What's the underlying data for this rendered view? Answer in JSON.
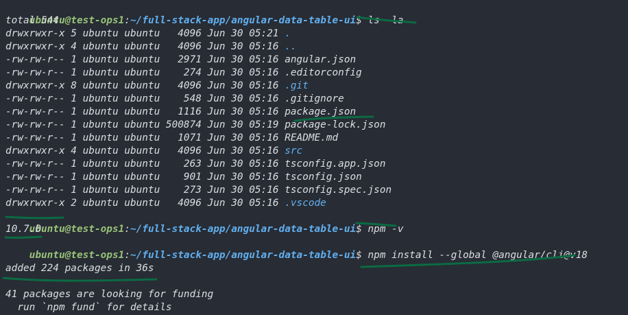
{
  "prompt": {
    "user_host": "ubuntu@test-ops1",
    "sep": ":",
    "path": "~/full-stack-app/angular-data-table-ui",
    "dollar": "$ "
  },
  "commands": {
    "ls": "ls -la",
    "npm_version": "npm -v",
    "npm_install": "npm install --global @angular/cli@v18"
  },
  "ls_output": {
    "total": "total 544",
    "entries": [
      {
        "meta": "drwxrwxr-x 5 ubuntu ubuntu   4096 Jun 30 05:21 ",
        "name": ".",
        "is_dir": true
      },
      {
        "meta": "drwxrwxr-x 4 ubuntu ubuntu   4096 Jun 30 05:16 ",
        "name": "..",
        "is_dir": true
      },
      {
        "meta": "-rw-rw-r-- 1 ubuntu ubuntu   2971 Jun 30 05:16 ",
        "name": "angular.json",
        "is_dir": false
      },
      {
        "meta": "-rw-rw-r-- 1 ubuntu ubuntu    274 Jun 30 05:16 ",
        "name": ".editorconfig",
        "is_dir": false
      },
      {
        "meta": "drwxrwxr-x 8 ubuntu ubuntu   4096 Jun 30 05:16 ",
        "name": ".git",
        "is_dir": true
      },
      {
        "meta": "-rw-rw-r-- 1 ubuntu ubuntu    548 Jun 30 05:16 ",
        "name": ".gitignore",
        "is_dir": false
      },
      {
        "meta": "-rw-rw-r-- 1 ubuntu ubuntu   1116 Jun 30 05:16 ",
        "name": "package.json",
        "is_dir": false
      },
      {
        "meta": "-rw-rw-r-- 1 ubuntu ubuntu 500874 Jun 30 05:19 ",
        "name": "package-lock.json",
        "is_dir": false
      },
      {
        "meta": "-rw-rw-r-- 1 ubuntu ubuntu   1071 Jun 30 05:16 ",
        "name": "README.md",
        "is_dir": false
      },
      {
        "meta": "drwxrwxr-x 4 ubuntu ubuntu   4096 Jun 30 05:16 ",
        "name": "src",
        "is_dir": true
      },
      {
        "meta": "-rw-rw-r-- 1 ubuntu ubuntu    263 Jun 30 05:16 ",
        "name": "tsconfig.app.json",
        "is_dir": false
      },
      {
        "meta": "-rw-rw-r-- 1 ubuntu ubuntu    901 Jun 30 05:16 ",
        "name": "tsconfig.json",
        "is_dir": false
      },
      {
        "meta": "-rw-rw-r-- 1 ubuntu ubuntu    273 Jun 30 05:16 ",
        "name": "tsconfig.spec.json",
        "is_dir": false
      },
      {
        "meta": "drwxrwxr-x 2 ubuntu ubuntu   4096 Jun 30 05:16 ",
        "name": ".vscode",
        "is_dir": true
      }
    ]
  },
  "npm_version_output": "10.7.0",
  "npm_install_output": {
    "added": "added 224 packages in 36s",
    "blank": "",
    "funding": "41 packages are looking for funding",
    "funding_hint": "  run `npm fund` for details"
  },
  "colors": {
    "background": "#282c34",
    "text": "#dcdfe4",
    "prompt_user": "#98c379",
    "prompt_path": "#61afef",
    "directory": "#61afef",
    "annotation": "#0b6b43"
  }
}
